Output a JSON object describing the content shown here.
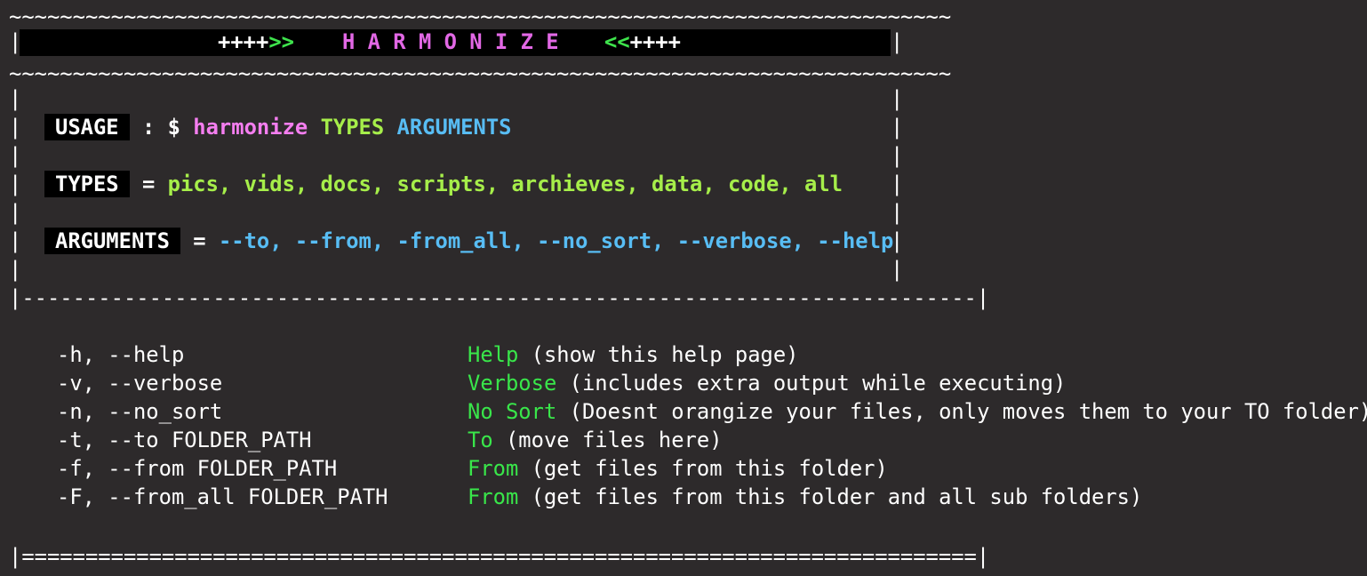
{
  "banner": {
    "border_top": "~~~~~~~~~~~~~~~~~~~~~~~~~~~~~~~~~~~~~~~~~~~~~~~~~~~~~~~~~~~~~~~~~~~~~~~~~~",
    "border_bottom": "~~~~~~~~~~~~~~~~~~~~~~~~~~~~~~~~~~~~~~~~~~~~~~~~~~~~~~~~~~~~~~~~~~~~~~~~~~",
    "left_plus": "++++",
    "left_arrows": ">>",
    "title": "H A R M O N I Z E",
    "right_arrows": "<<",
    "right_plus": "++++"
  },
  "usage": {
    "label": "USAGE",
    "separator": " : $ ",
    "command": "harmonize",
    "types_word": "TYPES",
    "arguments_word": "ARGUMENTS"
  },
  "types": {
    "label": "TYPES",
    "equals": " = ",
    "list": "pics, vids, docs, scripts, archieves, data, code, all"
  },
  "arguments": {
    "label": "ARGUMENTS",
    "equals": " = ",
    "list": "--to, --from, -from_all, --no_sort, --verbose, --help"
  },
  "box": {
    "dash_border": "|---------------------------------------------------------------------------|",
    "eq_border": "|===========================================================================|"
  },
  "options": [
    {
      "flag": "-h, --help",
      "name": "Help",
      "desc": "(show this help page)"
    },
    {
      "flag": "-v, --verbose",
      "name": "Verbose",
      "desc": "(includes extra output while executing)"
    },
    {
      "flag": "-n, --no_sort",
      "name": "No Sort",
      "desc": "(Doesnt orangize your files, only moves them to your TO folder)"
    },
    {
      "flag": "-t, --to FOLDER_PATH",
      "name": "To",
      "desc": "(move files here)"
    },
    {
      "flag": "-f, --from FOLDER_PATH",
      "name": "From",
      "desc": "(get files from this folder)"
    },
    {
      "flag": "-F, --from_all FOLDER_PATH",
      "name": "From",
      "desc": "(get files from this folder and all sub folders)"
    }
  ]
}
